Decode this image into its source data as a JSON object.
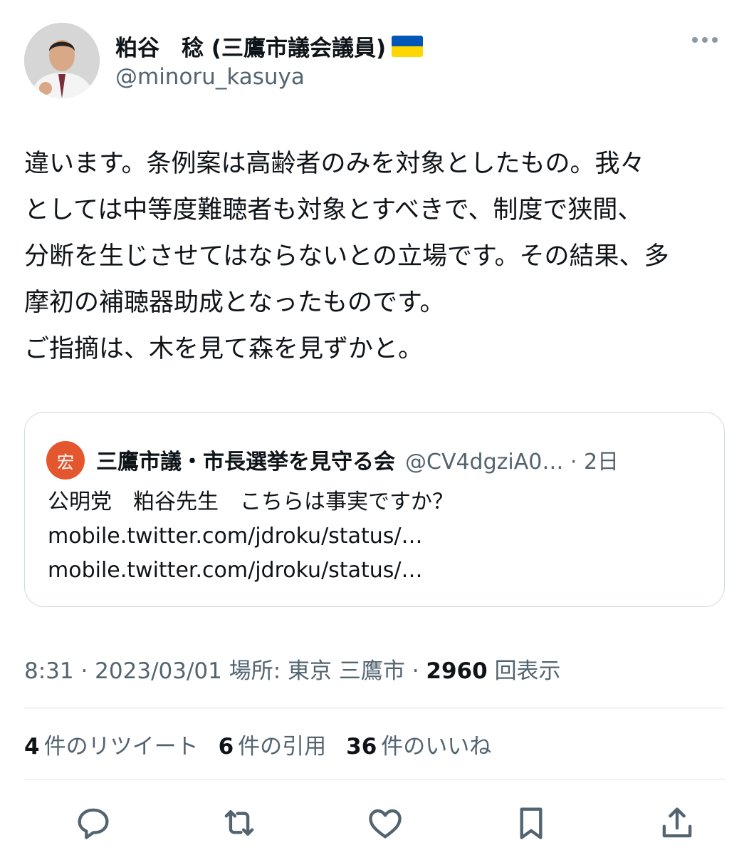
{
  "author": {
    "name": "粕谷　稔 (三鷹市議会議員)",
    "handle": "@minoru_kasuya",
    "flag_icon": "ukraine-flag-icon",
    "flag_colors": [
      "#0057b7",
      "#ffd700"
    ]
  },
  "tweet": {
    "lines": [
      "違います。条例案は高齢者のみを対象としたもの。我々",
      "としては中等度難聴者も対象とすべきで、制度で狭間、",
      "分断を生じさせてはならないとの立場です。その結果、多",
      "摩初の補聴器助成となったものです。",
      "ご指摘は、木を見て森を見ずかと。"
    ]
  },
  "quote": {
    "avatar_char": "宏",
    "avatar_color": "#e4572e",
    "name": "三鷹市議・市長選挙を見守る会",
    "meta": "@CV4dgziA0… · 2日",
    "lines": [
      "公明党　粕谷先生　こちらは事実ですか？",
      "mobile.twitter.com/jdroku/status/…",
      "mobile.twitter.com/jdroku/status/…"
    ]
  },
  "meta": {
    "time_location": "8:31 · 2023/03/01 場所: 東京 三鷹市 · ",
    "views_count": "2960",
    "views_label": "回表示"
  },
  "stats": {
    "retweets_count": "4",
    "retweets_label": "件のリツイート",
    "quotes_count": "6",
    "quotes_label": "件の引用",
    "likes_count": "36",
    "likes_label": "件のいいね"
  },
  "actions": [
    "reply-icon",
    "retweet-icon",
    "like-icon",
    "bookmark-icon",
    "share-icon"
  ],
  "colors": {
    "text": "#0f1419",
    "secondary": "#536471",
    "border": "#cfd9de"
  }
}
